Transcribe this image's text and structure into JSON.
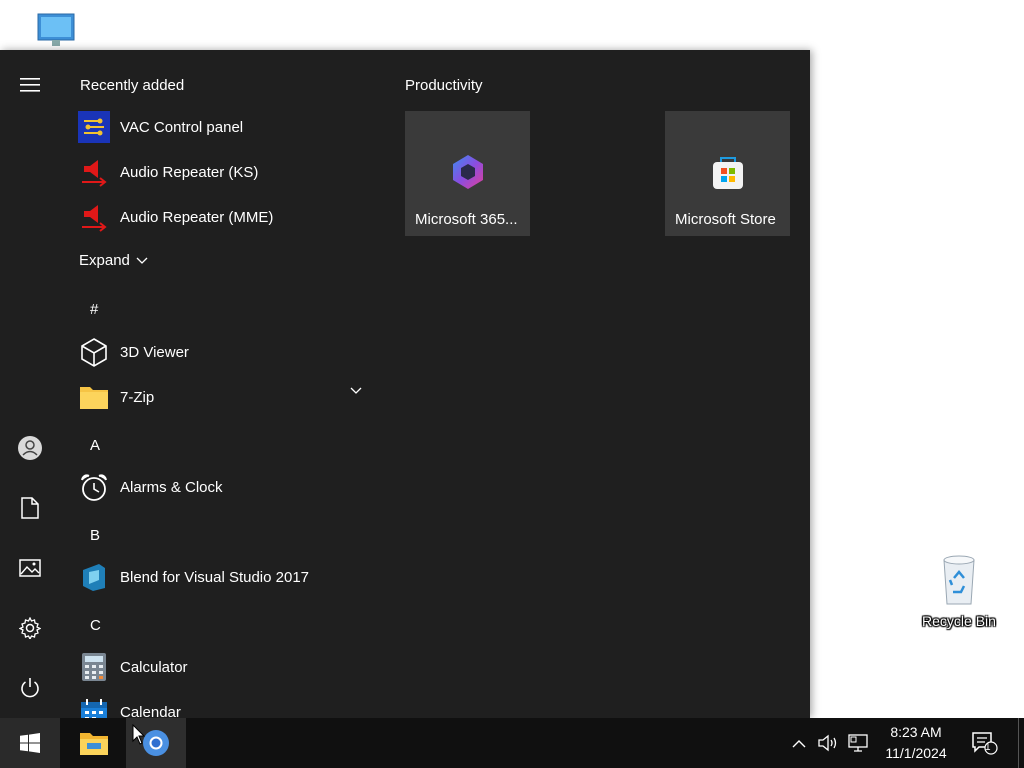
{
  "desktop": {
    "recycle_bin_label": "Recycle Bin"
  },
  "start_menu": {
    "recently_added_title": "Recently added",
    "recently_added": [
      {
        "label": "VAC Control panel",
        "icon": "vac-control-icon"
      },
      {
        "label": "Audio Repeater (KS)",
        "icon": "audio-repeater-icon"
      },
      {
        "label": "Audio Repeater (MME)",
        "icon": "audio-repeater-icon"
      }
    ],
    "expand_label": "Expand",
    "letters": {
      "hash": "#",
      "a": "A",
      "b": "B",
      "c": "C"
    },
    "apps": {
      "viewer_3d": "3D Viewer",
      "seven_zip": "7-Zip",
      "alarms": "Alarms & Clock",
      "blend": "Blend for Visual Studio 2017",
      "calculator": "Calculator",
      "calendar": "Calendar"
    },
    "tiles_group_title": "Productivity",
    "tiles": [
      {
        "label": "Microsoft 365...",
        "icon": "microsoft-365-icon"
      },
      {
        "label": "Microsoft Store",
        "icon": "microsoft-store-icon"
      }
    ],
    "rail": [
      "menu-icon",
      "user-icon",
      "document-icon",
      "pictures-icon",
      "settings-icon",
      "power-icon"
    ]
  },
  "taskbar": {
    "time": "8:23 AM",
    "date": "11/1/2024",
    "notification_count": "1"
  }
}
